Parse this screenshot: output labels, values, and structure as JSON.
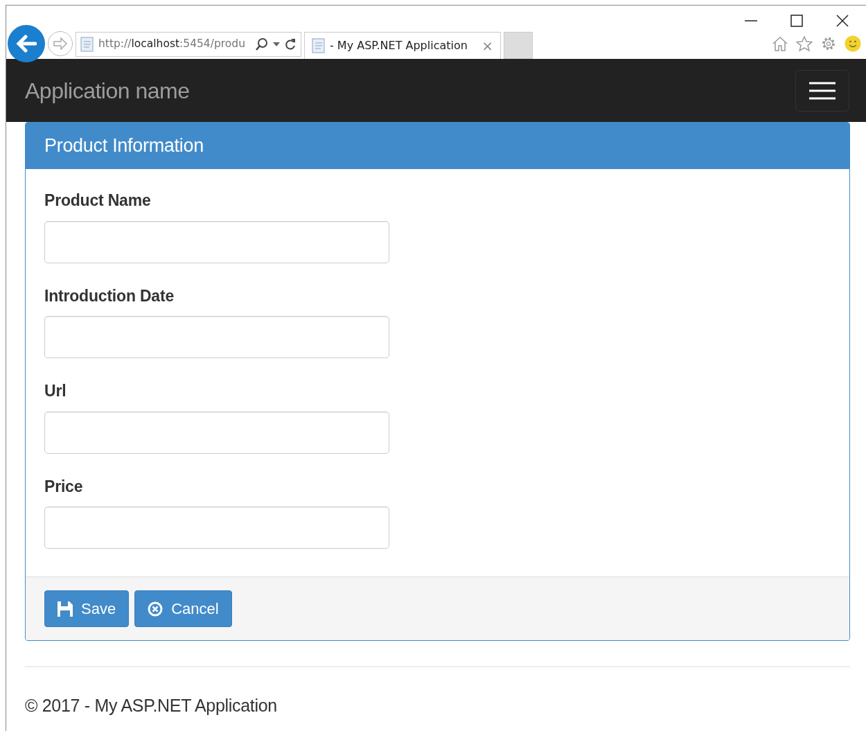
{
  "browser": {
    "address": "http://**localhost**:5454/produ",
    "tab": {
      "title": "- My ASP.NET Application",
      "close": "×"
    }
  },
  "navbar": {
    "brand": "Application name"
  },
  "panel": {
    "title": "Product Information",
    "fields": [
      {
        "label": "Product Name"
      },
      {
        "label": "Introduction Date"
      },
      {
        "label": "Url"
      },
      {
        "label": "Price"
      }
    ],
    "buttons": [
      {
        "kind": "save",
        "label": "Save"
      },
      {
        "kind": "cancel",
        "label": "Cancel"
      }
    ]
  },
  "footer": {
    "text": "© 2017 - My ASP.NET Application"
  }
}
